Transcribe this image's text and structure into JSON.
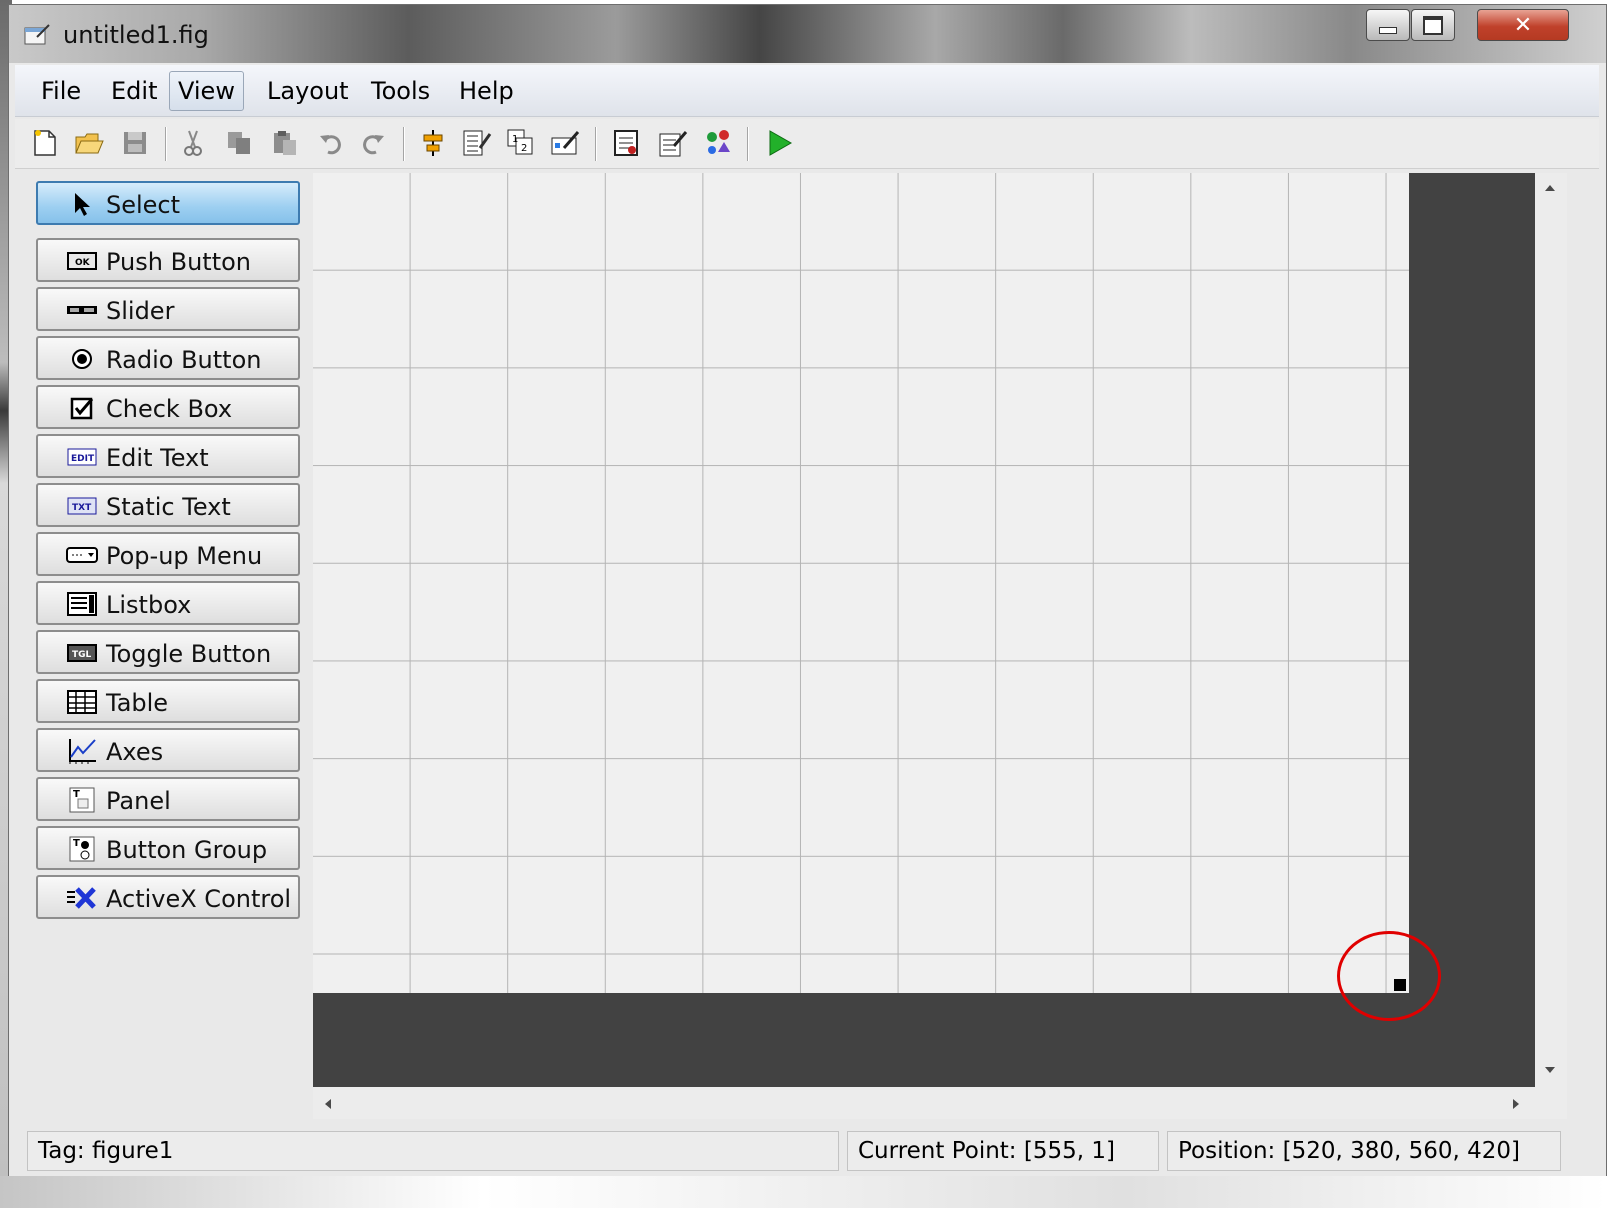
{
  "window": {
    "title": "untitled1.fig"
  },
  "menu": [
    "File",
    "Edit",
    "View",
    "Layout",
    "Tools",
    "Help"
  ],
  "menu_active": "View",
  "toolbar": {
    "icons": [
      "new-icon",
      "open-icon",
      "save-icon",
      "cut-icon",
      "copy-icon",
      "paste-icon",
      "undo-icon",
      "redo-icon",
      "align-objects-icon",
      "menu-editor-icon",
      "tab-order-editor-icon",
      "toolbar-editor-icon",
      "m-file-editor-icon",
      "property-inspector-icon",
      "object-browser-icon",
      "run-figure-icon"
    ]
  },
  "palette": {
    "items": [
      {
        "label": "Select",
        "icon": "arrow-pointer-icon",
        "selected": true
      },
      {
        "label": "Push Button",
        "icon": "push-button-icon"
      },
      {
        "label": "Slider",
        "icon": "slider-icon"
      },
      {
        "label": "Radio Button",
        "icon": "radio-button-icon"
      },
      {
        "label": "Check Box",
        "icon": "check-box-icon"
      },
      {
        "label": "Edit Text",
        "icon": "edit-text-icon"
      },
      {
        "label": "Static Text",
        "icon": "static-text-icon"
      },
      {
        "label": "Pop-up Menu",
        "icon": "popup-menu-icon"
      },
      {
        "label": "Listbox",
        "icon": "listbox-icon"
      },
      {
        "label": "Toggle Button",
        "icon": "toggle-button-icon"
      },
      {
        "label": "Table",
        "icon": "table-icon"
      },
      {
        "label": "Axes",
        "icon": "axes-icon"
      },
      {
        "label": "Panel",
        "icon": "panel-icon"
      },
      {
        "label": "Button Group",
        "icon": "button-group-icon"
      },
      {
        "label": "ActiveX Control",
        "icon": "activex-control-icon"
      }
    ]
  },
  "status": {
    "tag": "Tag: figure1",
    "current_point": "Current Point:  [555, 1]",
    "position": "Position: [520, 380, 560, 420]"
  },
  "colors": {
    "annotation": "#e00000",
    "selected_tool": "#9dcff1",
    "canvas_bg": "#424242"
  }
}
